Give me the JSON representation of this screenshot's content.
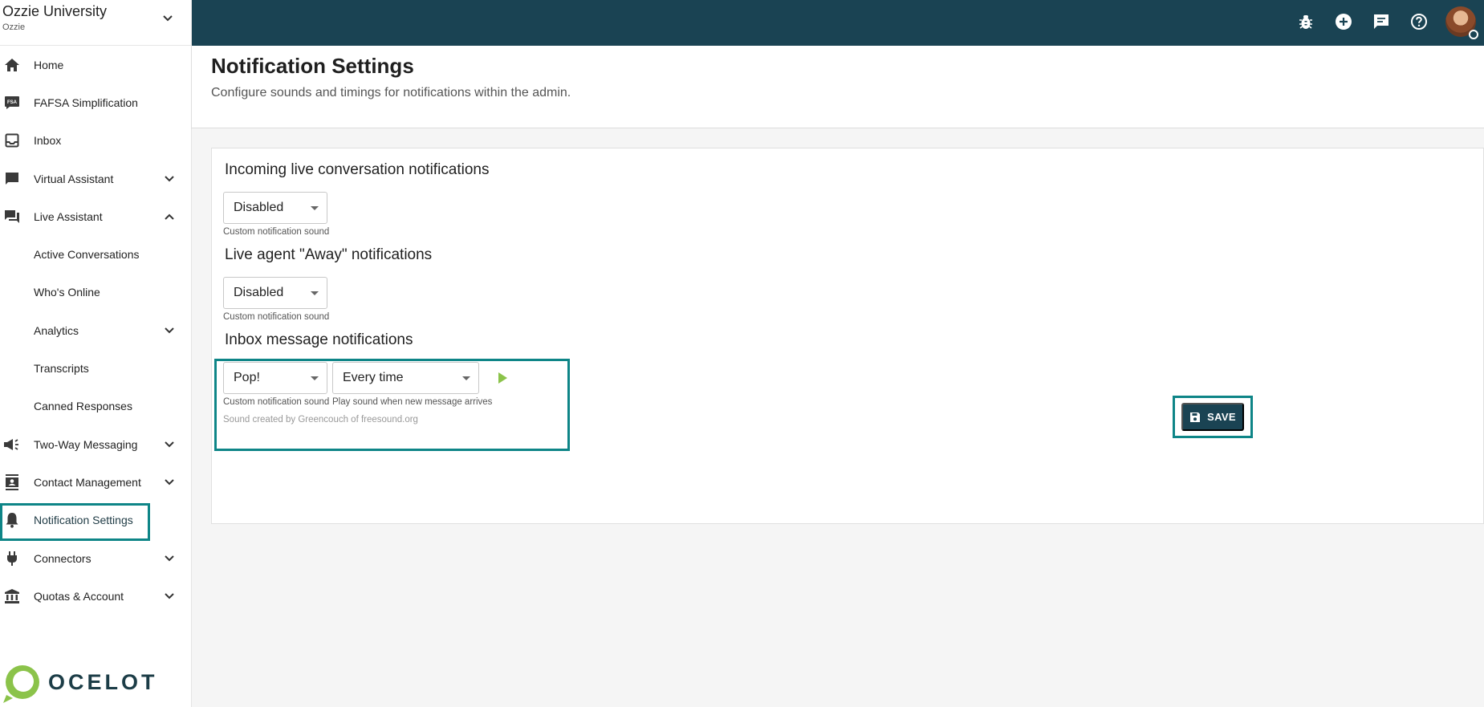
{
  "org": {
    "name": "Ozzie University",
    "sub": "Ozzie"
  },
  "sidebar": {
    "items": [
      {
        "label": "Home",
        "icon": "home-icon",
        "chevron": ""
      },
      {
        "label": "FAFSA Simplification",
        "icon": "fsa-icon",
        "icon_text": "FSA",
        "chevron": ""
      },
      {
        "label": "Inbox",
        "icon": "inbox-icon",
        "chevron": ""
      },
      {
        "label": "Virtual Assistant",
        "icon": "chat-icon",
        "chevron": "down"
      },
      {
        "label": "Live Assistant",
        "icon": "forum-icon",
        "chevron": "up"
      },
      {
        "label": "Active Conversations",
        "sub": true
      },
      {
        "label": "Who's Online",
        "sub": true
      },
      {
        "label": "Analytics",
        "sub": true,
        "chevron": "down"
      },
      {
        "label": "Transcripts",
        "sub": true
      },
      {
        "label": "Canned Responses",
        "sub": true
      },
      {
        "label": "Two-Way Messaging",
        "icon": "megaphone-icon",
        "chevron": "down"
      },
      {
        "label": "Contact Management",
        "icon": "contact-icon",
        "chevron": "down"
      },
      {
        "label": "Notification Settings",
        "icon": "bell-icon",
        "chevron": "",
        "active": true
      },
      {
        "label": "Connectors",
        "icon": "plug-icon",
        "chevron": "down"
      },
      {
        "label": "Quotas & Account",
        "icon": "bank-icon",
        "chevron": "down"
      }
    ]
  },
  "logo": {
    "text": "OCELOT"
  },
  "topbar": {
    "icons": [
      "bug-icon",
      "add-circle-icon",
      "feedback-icon",
      "help-icon"
    ]
  },
  "page": {
    "title": "Notification Settings",
    "subtitle": "Configure sounds and timings for notifications within the admin."
  },
  "sections": {
    "incoming": {
      "title": "Incoming live conversation notifications",
      "sound_value": "Disabled",
      "sound_helper": "Custom notification sound"
    },
    "away": {
      "title": "Live agent \"Away\" notifications",
      "sound_value": "Disabled",
      "sound_helper": "Custom notification sound"
    },
    "inbox": {
      "title": "Inbox message notifications",
      "sound_value": "Pop!",
      "sound_helper": "Custom notification sound",
      "timing_value": "Every time",
      "timing_helper": "Play sound when new message arrives",
      "credit": "Sound created by Greencouch of freesound.org"
    }
  },
  "save": {
    "label": "SAVE"
  },
  "colors": {
    "topbar": "#1a4353",
    "highlight": "#0e8587",
    "play": "#8bc34a"
  }
}
